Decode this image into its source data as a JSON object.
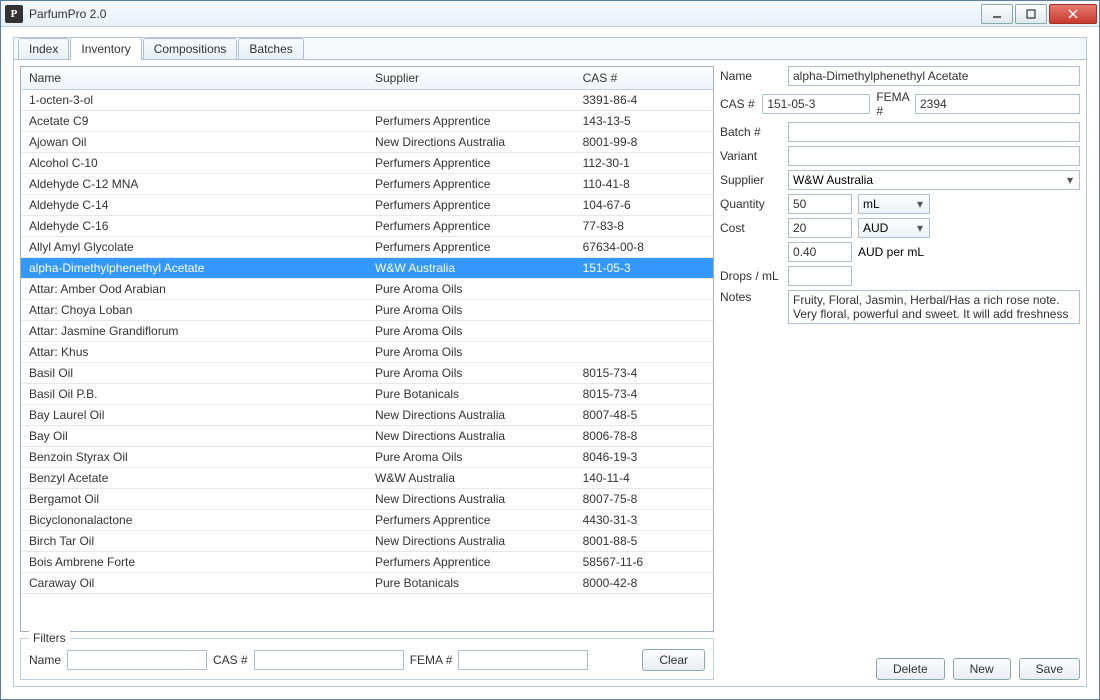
{
  "titlebar": {
    "app_name": "ParfumPro 2.0"
  },
  "tabs": [
    "Index",
    "Inventory",
    "Compositions",
    "Batches"
  ],
  "active_tab_index": 1,
  "columns": [
    "Name",
    "Supplier",
    "CAS #"
  ],
  "rows": [
    {
      "name": "1-octen-3-ol",
      "supplier": "",
      "cas": "3391-86-4"
    },
    {
      "name": "Acetate C9",
      "supplier": "Perfumers Apprentice",
      "cas": "143-13-5"
    },
    {
      "name": "Ajowan Oil",
      "supplier": "New Directions Australia",
      "cas": "8001-99-8"
    },
    {
      "name": "Alcohol C-10",
      "supplier": "Perfumers Apprentice",
      "cas": "112-30-1"
    },
    {
      "name": "Aldehyde C-12 MNA",
      "supplier": "Perfumers Apprentice",
      "cas": "110-41-8"
    },
    {
      "name": "Aldehyde C-14",
      "supplier": "Perfumers Apprentice",
      "cas": "104-67-6"
    },
    {
      "name": "Aldehyde C-16",
      "supplier": "Perfumers Apprentice",
      "cas": "77-83-8"
    },
    {
      "name": "Allyl Amyl Glycolate",
      "supplier": "Perfumers Apprentice",
      "cas": "67634-00-8"
    },
    {
      "name": "alpha-Dimethylphenethyl Acetate",
      "supplier": "W&W Australia",
      "cas": "151-05-3",
      "selected": true
    },
    {
      "name": "Attar: Amber Ood Arabian",
      "supplier": "Pure Aroma Oils",
      "cas": ""
    },
    {
      "name": "Attar: Choya Loban",
      "supplier": "Pure Aroma Oils",
      "cas": ""
    },
    {
      "name": "Attar: Jasmine Grandiflorum",
      "supplier": "Pure Aroma Oils",
      "cas": ""
    },
    {
      "name": "Attar: Khus",
      "supplier": "Pure Aroma Oils",
      "cas": ""
    },
    {
      "name": "Basil Oil",
      "supplier": "Pure Aroma Oils",
      "cas": "8015-73-4"
    },
    {
      "name": "Basil Oil P.B.",
      "supplier": "Pure Botanicals",
      "cas": "8015-73-4"
    },
    {
      "name": "Bay Laurel Oil",
      "supplier": "New Directions Australia",
      "cas": "8007-48-5"
    },
    {
      "name": "Bay Oil",
      "supplier": "New Directions Australia",
      "cas": "8006-78-8"
    },
    {
      "name": "Benzoin Styrax Oil",
      "supplier": "Pure Aroma Oils",
      "cas": "8046-19-3"
    },
    {
      "name": "Benzyl Acetate",
      "supplier": "W&W Australia",
      "cas": "140-11-4"
    },
    {
      "name": "Bergamot Oil",
      "supplier": "New Directions Australia",
      "cas": "8007-75-8"
    },
    {
      "name": "Bicyclononalactone",
      "supplier": "Perfumers Apprentice",
      "cas": "4430-31-3"
    },
    {
      "name": "Birch Tar Oil",
      "supplier": "New Directions Australia",
      "cas": "8001-88-5"
    },
    {
      "name": "Bois Ambrene Forte",
      "supplier": "Perfumers Apprentice",
      "cas": "58567-11-6"
    },
    {
      "name": "Caraway Oil",
      "supplier": "Pure Botanicals",
      "cas": "8000-42-8"
    }
  ],
  "filters": {
    "legend": "Filters",
    "name_label": "Name",
    "name_value": "",
    "cas_label": "CAS #",
    "cas_value": "",
    "fema_label": "FEMA #",
    "fema_value": "",
    "clear": "Clear"
  },
  "detail": {
    "name_label": "Name",
    "name": "alpha-Dimethylphenethyl Acetate",
    "cas_label": "CAS #",
    "cas": "151-05-3",
    "fema_label": "FEMA #",
    "fema": "2394",
    "batch_label": "Batch #",
    "batch": "",
    "variant_label": "Variant",
    "variant": "",
    "supplier_label": "Supplier",
    "supplier": "W&W Australia",
    "quantity_label": "Quantity",
    "quantity": "50",
    "quantity_unit": "mL",
    "cost_label": "Cost",
    "cost": "20",
    "cost_currency": "AUD",
    "unit_cost": "0.40",
    "unit_cost_label": "AUD per mL",
    "drops_label": "Drops / mL",
    "drops": "",
    "notes_label": "Notes",
    "notes": "Fruity, Floral, Jasmin, Herbal/Has a rich rose note. Very floral, powerful and sweet. It will add freshness and lift to almost any floral bouquet"
  },
  "buttons": {
    "delete": "Delete",
    "new": "New",
    "save": "Save"
  }
}
